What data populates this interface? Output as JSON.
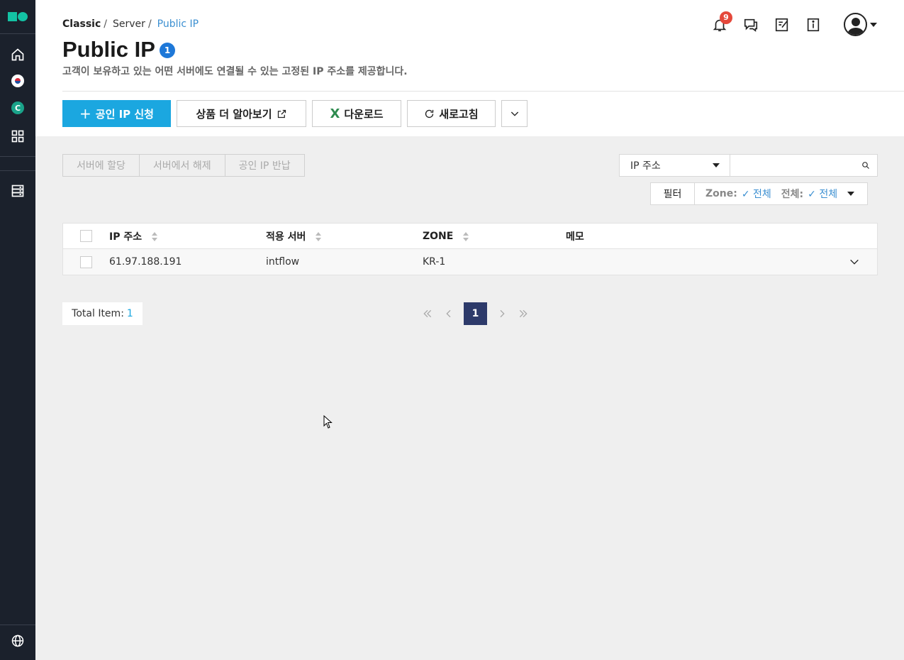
{
  "sidebar": {
    "logo": "nc-logo",
    "items": [
      {
        "name": "home-icon"
      },
      {
        "name": "korea-flag-icon"
      },
      {
        "name": "classic-icon",
        "label": "C"
      },
      {
        "name": "grid-icon"
      },
      {
        "name": "server-icon"
      },
      {
        "name": "globe-icon"
      }
    ]
  },
  "breadcrumb": {
    "items": [
      "Classic",
      "Server",
      "Public IP"
    ],
    "separator": "/"
  },
  "page": {
    "title": "Public IP",
    "count": "1",
    "description": "고객이 보유하고 있는 어떤 서버에도 연결될 수 있는 고정된 IP 주소를 제공합니다."
  },
  "header": {
    "notification_count": "9",
    "icons": [
      "bell-icon",
      "chat-icon",
      "note-icon",
      "info-icon",
      "avatar"
    ]
  },
  "toolbar": {
    "apply": "공인 IP 신청",
    "learn_more": "상품 더 알아보기",
    "download": "다운로드",
    "refresh": "새로고침"
  },
  "selection_actions": [
    "서버에 할당",
    "서버에서 해제",
    "공인 IP 반납"
  ],
  "search": {
    "field": "IP 주소",
    "placeholder": ""
  },
  "filter": {
    "label": "필터",
    "zone_key": "Zone:",
    "zone_value": "전체",
    "all_key": "전체:",
    "all_value": "전체"
  },
  "table": {
    "columns": [
      "IP 주소",
      "적용 서버",
      "ZONE",
      "메모"
    ],
    "rows": [
      {
        "ip": "61.97.188.191",
        "server": "intflow",
        "zone": "KR-1",
        "memo": ""
      }
    ]
  },
  "footer": {
    "total_label": "Total Item:",
    "total_value": "1",
    "current_page": "1"
  },
  "colors": {
    "sidebar_bg": "#1b212c",
    "brand": "#13c2a4",
    "primary": "#1ba7e0",
    "badge_red": "#e5483b",
    "page_current": "#2d3a6a",
    "link": "#3b8fd1"
  }
}
